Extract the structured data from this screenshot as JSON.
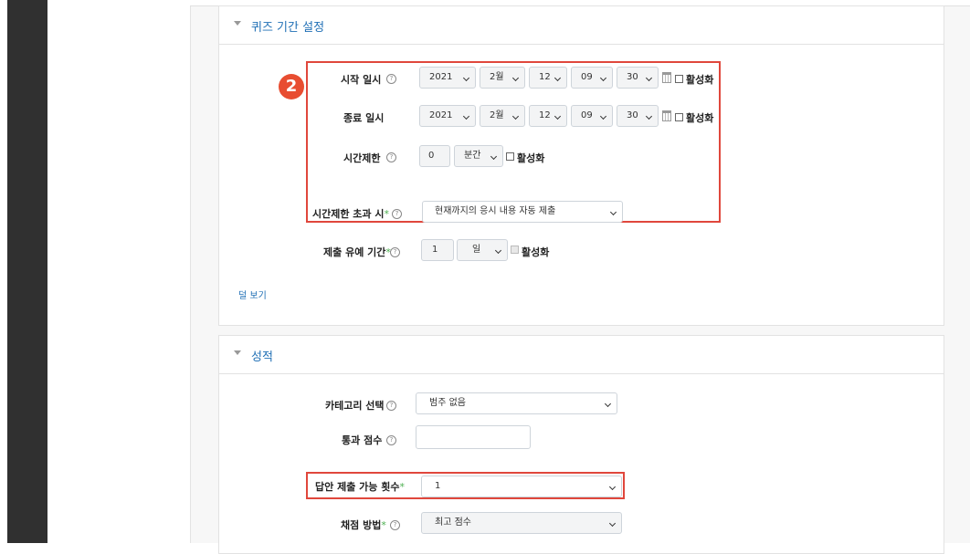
{
  "sections": {
    "quiz_period": {
      "title": "퀴즈 기간 설정",
      "badge": "2",
      "open": {
        "label": "시작 일시",
        "year": "2021",
        "month": "2월",
        "day": "12",
        "hour": "09",
        "minute": "30",
        "enable_label": "활성화"
      },
      "close": {
        "label": "종료 일시",
        "year": "2021",
        "month": "2월",
        "day": "12",
        "hour": "09",
        "minute": "30",
        "enable_label": "활성화"
      },
      "time_limit": {
        "label": "시간제한",
        "value": "0",
        "unit": "분간",
        "enable_label": "활성화"
      },
      "overdue": {
        "label": "시간제한 초과 시",
        "value": "현재까지의 응시 내용 자동 제출"
      },
      "grace": {
        "label": "제출 유예 기간",
        "value": "1",
        "unit": "일",
        "enable_label": "활성화"
      },
      "show_less": "덜 보기"
    },
    "grade": {
      "title": "성적",
      "category": {
        "label": "카테고리 선택",
        "value": "범주 없음"
      },
      "pass_grade": {
        "label": "통과 점수",
        "value": ""
      },
      "attempts": {
        "label": "답안 제출 가능 횟수",
        "value": "1"
      },
      "method": {
        "label": "채점 방법",
        "value": "최고 점수"
      }
    }
  },
  "help_glyph": "?",
  "required_mark": "*",
  "colors": {
    "accent": "#1f6fb5",
    "highlight": "#e0473c",
    "badge": "#e84d31",
    "required": "#4caf50",
    "sidebar": "#303030"
  }
}
